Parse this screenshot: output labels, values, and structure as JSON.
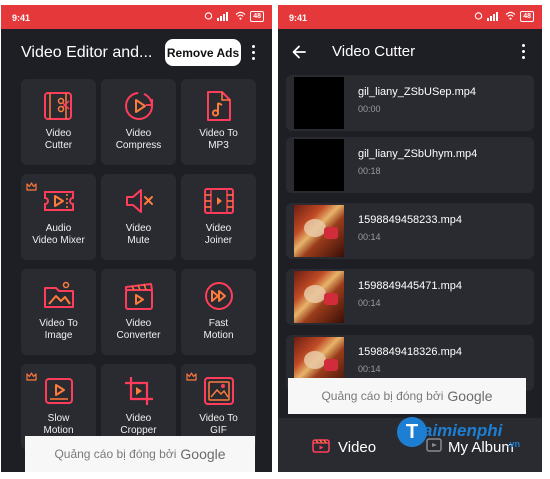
{
  "left": {
    "status": {
      "time": "9:41",
      "battery": "48"
    },
    "app_title": "Video Editor and...",
    "remove_ads_label": "Remove Ads",
    "tiles": [
      {
        "line1": "Video",
        "line2": "Cutter",
        "icon": "cut-video-icon",
        "premium": false
      },
      {
        "line1": "Video",
        "line2": "Compress",
        "icon": "compress-icon",
        "premium": false
      },
      {
        "line1": "Video To",
        "line2": "MP3",
        "icon": "music-file-icon",
        "premium": false
      },
      {
        "line1": "Audio",
        "line2": "Video Mixer",
        "icon": "ticket-audio-icon",
        "premium": true
      },
      {
        "line1": "Video",
        "line2": "Mute",
        "icon": "mute-speaker-icon",
        "premium": false
      },
      {
        "line1": "Video",
        "line2": "Joiner",
        "icon": "film-strip-icon",
        "premium": false
      },
      {
        "line1": "Video To",
        "line2": "Image",
        "icon": "image-folder-icon",
        "premium": false
      },
      {
        "line1": "Video",
        "line2": "Converter",
        "icon": "clapper-icon",
        "premium": false
      },
      {
        "line1": "Fast",
        "line2": "Motion",
        "icon": "fast-forward-icon",
        "premium": false
      },
      {
        "line1": "Slow",
        "line2": "Motion",
        "icon": "slow-play-icon",
        "premium": true
      },
      {
        "line1": "Video",
        "line2": "Cropper",
        "icon": "crop-icon",
        "premium": false
      },
      {
        "line1": "Video To",
        "line2": "GIF",
        "icon": "gif-image-icon",
        "premium": true
      }
    ],
    "ad_text": "Quảng cáo bị đóng bởi",
    "ad_brand": "Google"
  },
  "right": {
    "status": {
      "time": "9:41",
      "battery": "48"
    },
    "title": "Video Cutter",
    "videos": [
      {
        "name": "gil_liany_ZSbUSep.mp4",
        "duration": "00:00",
        "thumb": "black"
      },
      {
        "name": "gil_liany_ZSbUhym.mp4",
        "duration": "00:18",
        "thumb": "black"
      },
      {
        "name": "1598849458233.mp4",
        "duration": "00:14",
        "thumb": "pic"
      },
      {
        "name": "1598849445471.mp4",
        "duration": "00:14",
        "thumb": "pic"
      },
      {
        "name": "1598849418326.mp4",
        "duration": "00:14",
        "thumb": "pic"
      }
    ],
    "ad_text": "Quảng cáo bị đóng bởi",
    "ad_brand": "Google",
    "nav": {
      "video": "Video",
      "album": "My Album"
    }
  },
  "watermark": {
    "brand": "aimienphi",
    "tld": ".vn"
  },
  "colors": {
    "accent": "#ff3d5a",
    "accent_orange": "#ff7a3d",
    "bg": "#1e1f24",
    "tile": "#2a2b31",
    "statusbar": "#e5383b"
  }
}
